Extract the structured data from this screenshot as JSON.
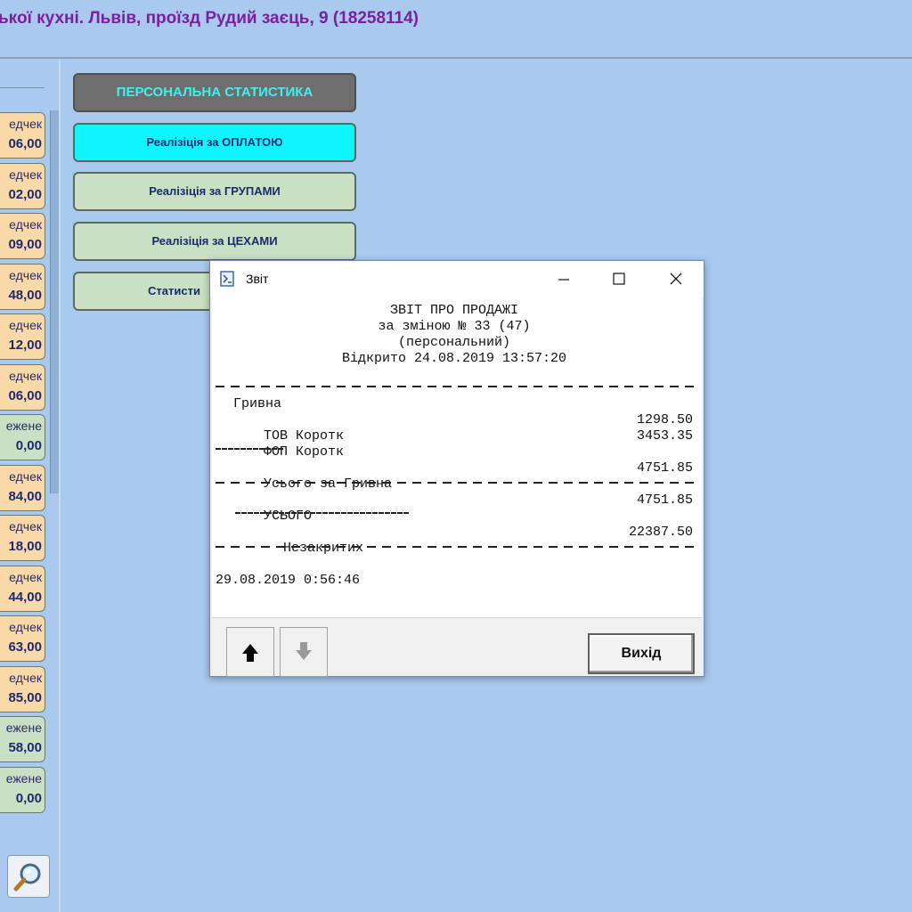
{
  "header": {
    "title": "ької кухні.   Львів, проїзд Рудий заєць, 9 (18258114)"
  },
  "tiles": [
    {
      "label": "едчек",
      "value": "06,00",
      "kind": "orange"
    },
    {
      "label": "едчек",
      "value": "02,00",
      "kind": "orange"
    },
    {
      "label": "едчек",
      "value": "09,00",
      "kind": "orange"
    },
    {
      "label": "едчек",
      "value": "48,00",
      "kind": "orange"
    },
    {
      "label": "едчек",
      "value": "12,00",
      "kind": "orange"
    },
    {
      "label": "едчек",
      "value": "06,00",
      "kind": "orange"
    },
    {
      "label": "ежене",
      "value": "0,00",
      "kind": "green"
    },
    {
      "label": "едчек",
      "value": "84,00",
      "kind": "orange"
    },
    {
      "label": "едчек",
      "value": "18,00",
      "kind": "orange"
    },
    {
      "label": "едчек",
      "value": "44,00",
      "kind": "orange"
    },
    {
      "label": "едчек",
      "value": "63,00",
      "kind": "orange"
    },
    {
      "label": "едчек",
      "value": "85,00",
      "kind": "orange"
    },
    {
      "label": "ежене",
      "value": "58,00",
      "kind": "green"
    },
    {
      "label": "ежене",
      "value": "0,00",
      "kind": "green"
    }
  ],
  "menu": {
    "stats_title": "ПЕРСОНАЛЬНА СТАТИСТИКА",
    "by_payment": "Реалізіція за ОПЛАТОЮ",
    "by_groups": "Реалізіція за ГРУПАМИ",
    "by_workshops": "Реалізіція за ЦЕХАМИ",
    "statistics": "Статисти"
  },
  "dialog": {
    "title": "Звіт",
    "report": {
      "heading": "ЗВІТ ПРО ПРОДАЖІ",
      "shift": "за зміною № 33 (47)",
      "mode": "(персональний)",
      "opened": "Відкрито 24.08.2019 13:57:20",
      "currency": "Гривна",
      "rows": [
        {
          "name": "ТОВ Коротк",
          "amount": "1298.50"
        },
        {
          "name": "ФОП Коротк",
          "amount": "3453.35"
        }
      ],
      "subtotal_label": "Усього за Гривна",
      "subtotal_value": "4751.85",
      "total_label": "УСЬОГО",
      "total_value": "4751.85",
      "open_label": "Незакритих",
      "open_value": "22387.50",
      "printed": "29.08.2019 0:56:46"
    },
    "exit_label": "Вихід"
  },
  "icons": {
    "app": "report-app-icon",
    "minimize": "minimize-icon",
    "maximize": "maximize-icon",
    "close": "close-icon",
    "up": "arrow-up-icon",
    "down": "arrow-down-icon",
    "search": "magnifier-icon"
  },
  "colors": {
    "background": "#a9c9ef",
    "title_text": "#7a1fa0",
    "tile_orange": "#f9d9a8",
    "tile_green": "#c9e0c4",
    "accent_cyan": "#0ff5ff",
    "stats_text": "#3ff0ef"
  }
}
